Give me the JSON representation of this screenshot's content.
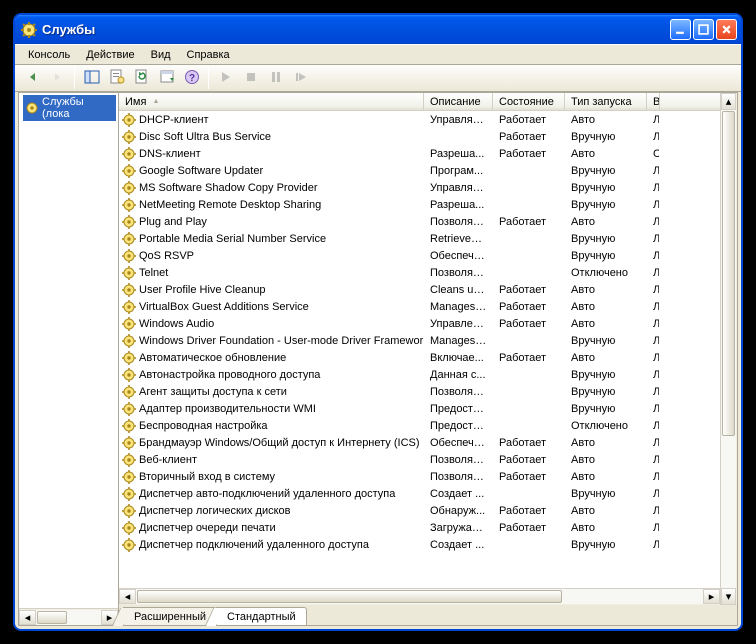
{
  "window": {
    "title": "Службы"
  },
  "menu": {
    "items": [
      "Консоль",
      "Действие",
      "Вид",
      "Справка"
    ]
  },
  "toolbar": {
    "buttons": [
      {
        "name": "back-button",
        "icon": "arrow-left",
        "enabled": true
      },
      {
        "name": "forward-button",
        "icon": "arrow-right",
        "enabled": false
      },
      {
        "name": "__sep"
      },
      {
        "name": "show-hide-tree-button",
        "icon": "panel",
        "enabled": true
      },
      {
        "name": "properties-button",
        "icon": "props",
        "enabled": true
      },
      {
        "name": "refresh-button",
        "icon": "refresh",
        "enabled": true
      },
      {
        "name": "export-button",
        "icon": "export",
        "enabled": true
      },
      {
        "name": "help-button",
        "icon": "help",
        "enabled": true
      },
      {
        "name": "__sep"
      },
      {
        "name": "start-service-button",
        "icon": "play",
        "enabled": false
      },
      {
        "name": "stop-service-button",
        "icon": "stop",
        "enabled": false
      },
      {
        "name": "pause-service-button",
        "icon": "pause",
        "enabled": false
      },
      {
        "name": "restart-service-button",
        "icon": "skip",
        "enabled": false
      }
    ]
  },
  "tree": {
    "node_label": "Службы (лока"
  },
  "columns": [
    {
      "label": "Имя",
      "sort": true
    },
    {
      "label": "Описание"
    },
    {
      "label": "Состояние"
    },
    {
      "label": "Тип запуска"
    },
    {
      "label": "В"
    }
  ],
  "services": [
    {
      "name": "DHCP-клиент",
      "desc": "Управляе...",
      "state": "Работает",
      "startup": "Авто",
      "logon": "Л"
    },
    {
      "name": "Disc Soft Ultra Bus Service",
      "desc": "",
      "state": "Работает",
      "startup": "Вручную",
      "logon": "Л"
    },
    {
      "name": "DNS-клиент",
      "desc": "Разреша...",
      "state": "Работает",
      "startup": "Авто",
      "logon": "С"
    },
    {
      "name": "Google Software Updater",
      "desc": "Програм...",
      "state": "",
      "startup": "Вручную",
      "logon": "Л"
    },
    {
      "name": "MS Software Shadow Copy Provider",
      "desc": "Управляе...",
      "state": "",
      "startup": "Вручную",
      "logon": "Л"
    },
    {
      "name": "NetMeeting Remote Desktop Sharing",
      "desc": "Разреша...",
      "state": "",
      "startup": "Вручную",
      "logon": "Л"
    },
    {
      "name": "Plug and Play",
      "desc": "Позволяе...",
      "state": "Работает",
      "startup": "Авто",
      "logon": "Л"
    },
    {
      "name": "Portable Media Serial Number Service",
      "desc": "Retrieves ...",
      "state": "",
      "startup": "Вручную",
      "logon": "Л"
    },
    {
      "name": "QoS RSVP",
      "desc": "Обеспечи...",
      "state": "",
      "startup": "Вручную",
      "logon": "Л"
    },
    {
      "name": "Telnet",
      "desc": "Позволяе...",
      "state": "",
      "startup": "Отключено",
      "logon": "Л"
    },
    {
      "name": "User Profile Hive Cleanup",
      "desc": "Cleans up ...",
      "state": "Работает",
      "startup": "Авто",
      "logon": "Л"
    },
    {
      "name": "VirtualBox Guest Additions Service",
      "desc": "Manages ...",
      "state": "Работает",
      "startup": "Авто",
      "logon": "Л"
    },
    {
      "name": "Windows Audio",
      "desc": "Управлен...",
      "state": "Работает",
      "startup": "Авто",
      "logon": "Л"
    },
    {
      "name": "Windows Driver Foundation - User-mode Driver Framework",
      "desc": "Manages ...",
      "state": "",
      "startup": "Вручную",
      "logon": "Л"
    },
    {
      "name": "Автоматическое обновление",
      "desc": "Включае...",
      "state": "Работает",
      "startup": "Авто",
      "logon": "Л"
    },
    {
      "name": "Автонастройка проводного доступа",
      "desc": "Данная с...",
      "state": "",
      "startup": "Вручную",
      "logon": "Л"
    },
    {
      "name": "Агент защиты доступа к сети",
      "desc": "Позволяе...",
      "state": "",
      "startup": "Вручную",
      "logon": "Л"
    },
    {
      "name": "Адаптер производительности WMI",
      "desc": "Предоста...",
      "state": "",
      "startup": "Вручную",
      "logon": "Л"
    },
    {
      "name": "Беспроводная настройка",
      "desc": "Предоста...",
      "state": "",
      "startup": "Отключено",
      "logon": "Л"
    },
    {
      "name": "Брандмауэр Windows/Общий доступ к Интернету (ICS)",
      "desc": "Обеспечи...",
      "state": "Работает",
      "startup": "Авто",
      "logon": "Л"
    },
    {
      "name": "Веб-клиент",
      "desc": "Позволяе...",
      "state": "Работает",
      "startup": "Авто",
      "logon": "Л"
    },
    {
      "name": "Вторичный вход в систему",
      "desc": "Позволяе...",
      "state": "Работает",
      "startup": "Авто",
      "logon": "Л"
    },
    {
      "name": "Диспетчер авто-подключений удаленного доступа",
      "desc": "Создает ...",
      "state": "",
      "startup": "Вручную",
      "logon": "Л"
    },
    {
      "name": "Диспетчер логических дисков",
      "desc": "Обнаруж...",
      "state": "Работает",
      "startup": "Авто",
      "logon": "Л"
    },
    {
      "name": "Диспетчер очереди печати",
      "desc": "Загружае...",
      "state": "Работает",
      "startup": "Авто",
      "logon": "Л"
    },
    {
      "name": "Диспетчер подключений удаленного доступа",
      "desc": "Создает ...",
      "state": "",
      "startup": "Вручную",
      "logon": "Л"
    }
  ],
  "tabs": {
    "items": [
      "Расширенный",
      "Стандартный"
    ],
    "active": 1
  }
}
